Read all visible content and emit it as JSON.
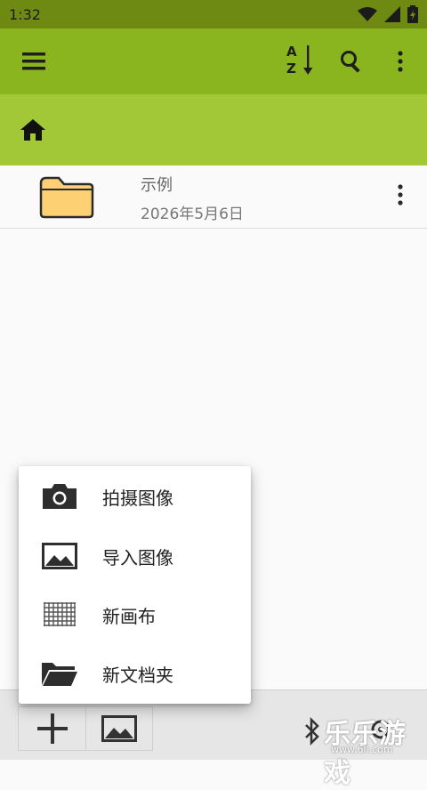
{
  "status_bar": {
    "time": "1:32"
  },
  "toolbar": {
    "menu_icon": "menu-icon",
    "sort_icon": "sort-az-icon",
    "sort_label_a": "A",
    "sort_label_z": "Z",
    "search_icon": "search-icon",
    "more_icon": "more-vert-icon",
    "bg_color": "#8ab51e"
  },
  "path_bar": {
    "home_icon": "home-icon",
    "bg_color": "#a2c737"
  },
  "files": [
    {
      "name": "示例",
      "date": "2026年5月6日",
      "icon": "folder-icon"
    }
  ],
  "popup_menu": {
    "items": [
      {
        "label": "拍摄图像",
        "icon": "camera-icon"
      },
      {
        "label": "导入图像",
        "icon": "image-icon"
      },
      {
        "label": "新画布",
        "icon": "grid-canvas-icon"
      },
      {
        "label": "新文档夹",
        "icon": "folder-open-icon"
      }
    ]
  },
  "bottom_bar": {
    "add_icon": "plus-icon",
    "image_icon": "image-icon",
    "bluetooth_icon": "bluetooth-icon"
  },
  "watermark": {
    "title": "乐乐游戏",
    "url": "www.6ll.com"
  }
}
